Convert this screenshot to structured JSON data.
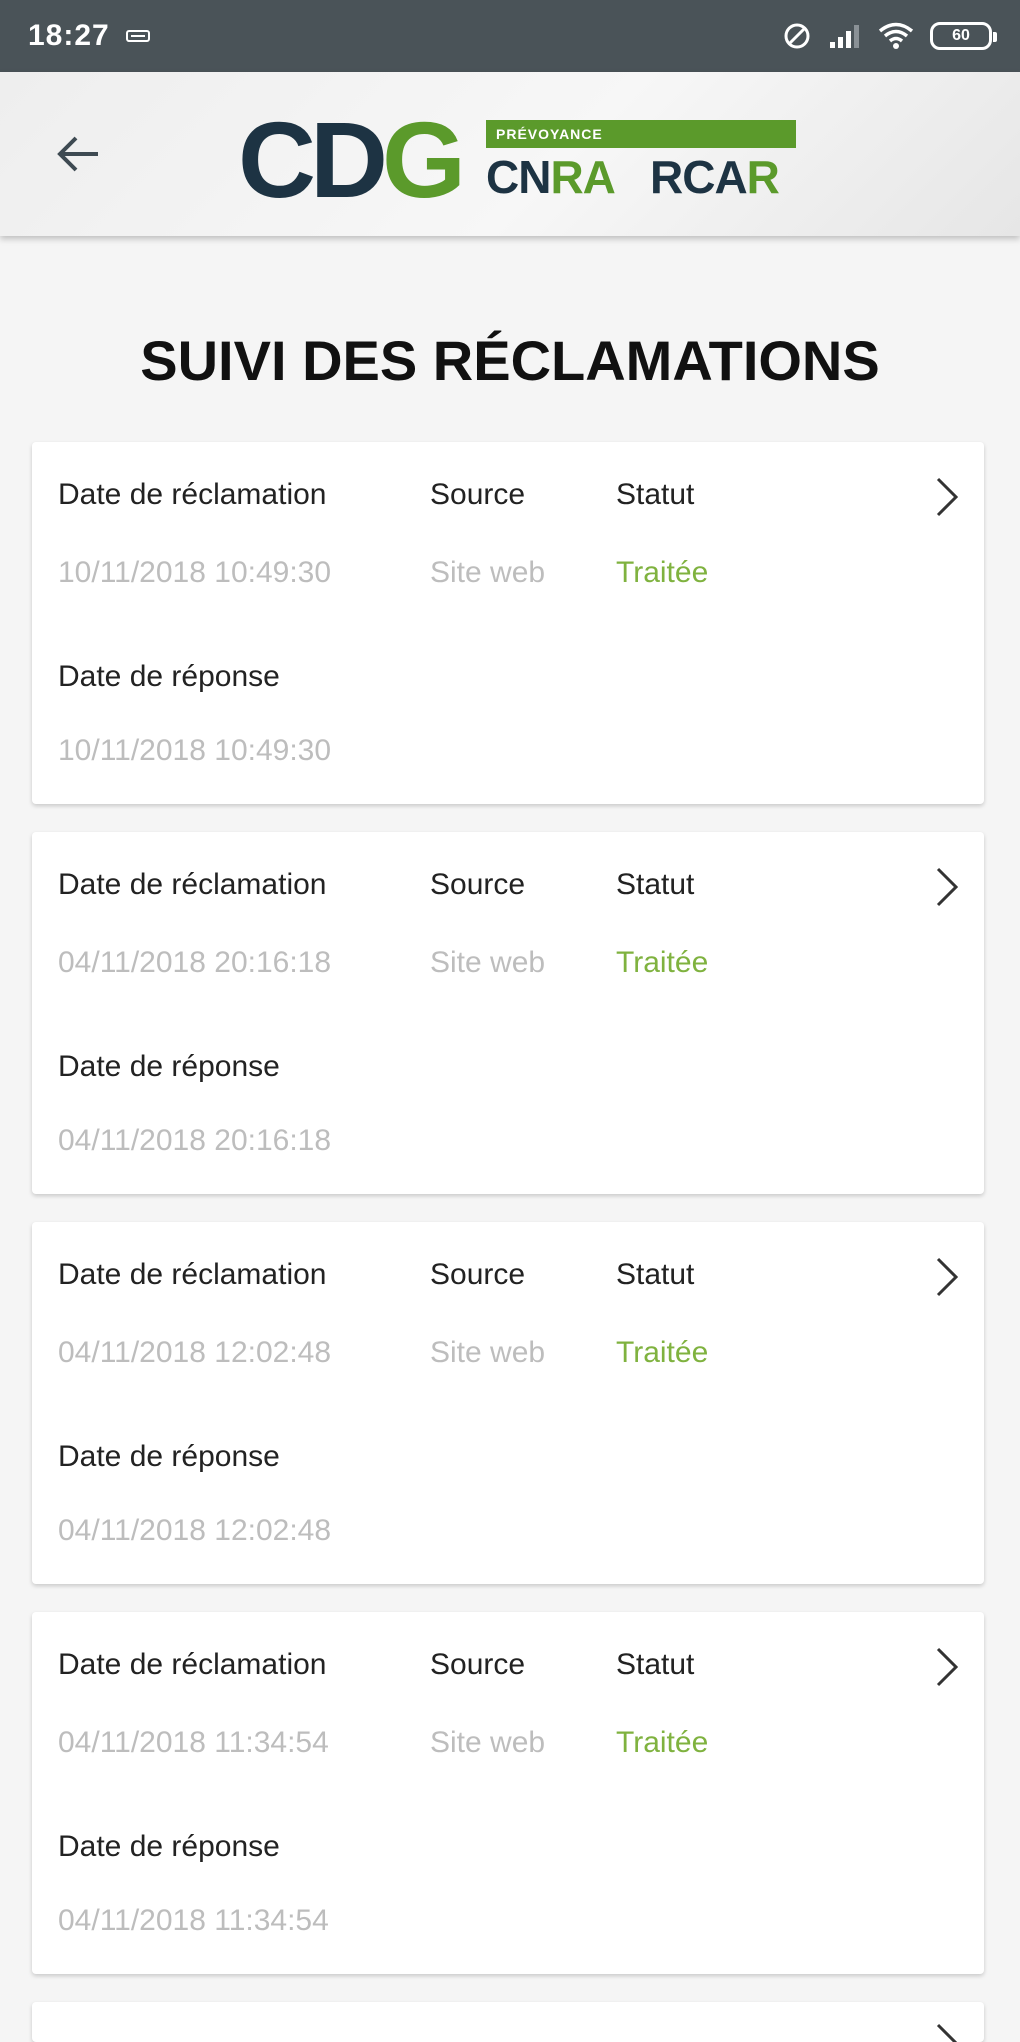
{
  "status_bar": {
    "time": "18:27",
    "battery": "60"
  },
  "header": {
    "logo_text": "CDG",
    "logo_banner": "PRÉVOYANCE",
    "logo_cnra": "CNRA",
    "logo_rcar": "RCAR"
  },
  "page": {
    "title": "SUIVI DES RÉCLAMATIONS"
  },
  "labels": {
    "date_reclamation": "Date de réclamation",
    "source": "Source",
    "statut": "Statut",
    "date_reponse": "Date de réponse"
  },
  "reclamations": [
    {
      "date": "10/11/2018 10:49:30",
      "source": "Site web",
      "statut": "Traitée",
      "reponse": "10/11/2018 10:49:30"
    },
    {
      "date": "04/11/2018 20:16:18",
      "source": "Site web",
      "statut": "Traitée",
      "reponse": "04/11/2018 20:16:18"
    },
    {
      "date": "04/11/2018 12:02:48",
      "source": "Site web",
      "statut": "Traitée",
      "reponse": "04/11/2018 12:02:48"
    },
    {
      "date": "04/11/2018 11:34:54",
      "source": "Site web",
      "statut": "Traitée",
      "reponse": "04/11/2018 11:34:54"
    }
  ],
  "colors": {
    "accent_green": "#5b9a2b",
    "status_green": "#7fb23f",
    "navy": "#1d3343"
  }
}
